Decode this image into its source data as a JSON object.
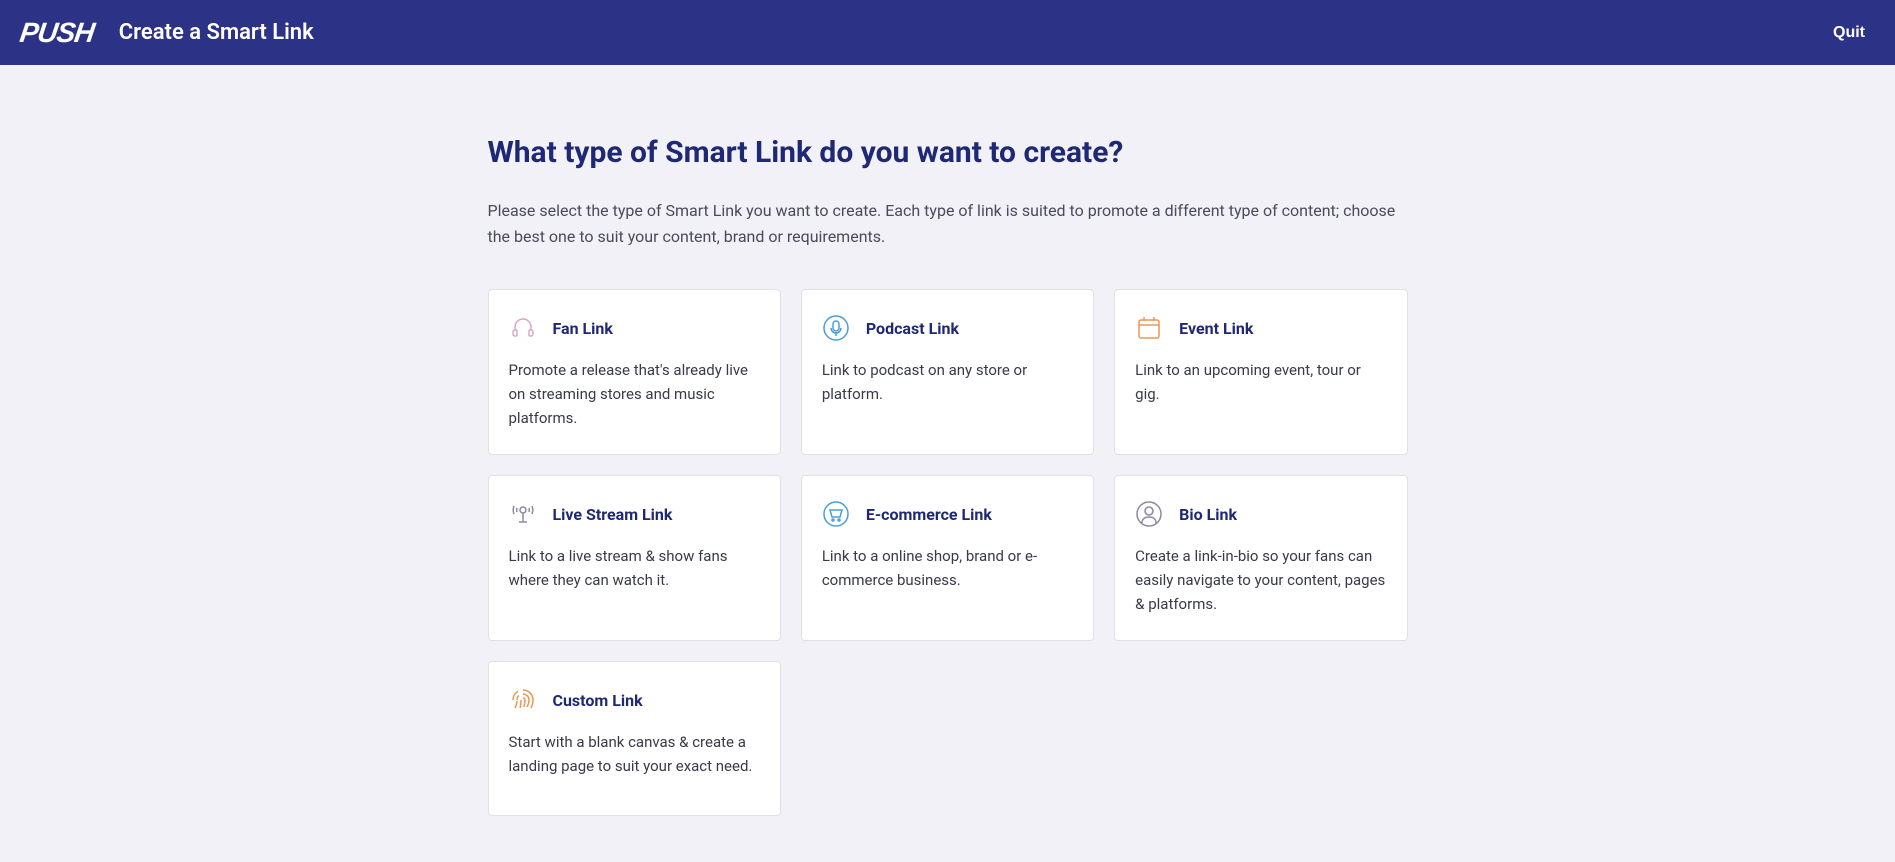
{
  "header": {
    "logo": "PUSH",
    "title": "Create a Smart Link",
    "quit_label": "Quit"
  },
  "main": {
    "heading": "What type of Smart Link do you want to create?",
    "description": "Please select the type of Smart Link you want to create. Each type of link is suited to promote a different type of content; choose the best one to suit your content, brand or requirements."
  },
  "cards": [
    {
      "icon": "headphones-icon",
      "title": "Fan Link",
      "description": "Promote a release that's already live on streaming stores and music platforms."
    },
    {
      "icon": "microphone-icon",
      "title": "Podcast Link",
      "description": "Link to podcast on any store or platform."
    },
    {
      "icon": "calendar-icon",
      "title": "Event Link",
      "description": "Link to an upcoming event, tour or gig."
    },
    {
      "icon": "broadcast-icon",
      "title": "Live Stream Link",
      "description": "Link to a live stream & show fans where they can watch it."
    },
    {
      "icon": "cart-icon",
      "title": "E-commerce Link",
      "description": "Link to a online shop, brand or e-commerce business."
    },
    {
      "icon": "person-icon",
      "title": "Bio Link",
      "description": "Create a link-in-bio so your fans can easily navigate to your content, pages & platforms."
    },
    {
      "icon": "fingerprint-icon",
      "title": "Custom Link",
      "description": "Start with a blank canvas & create a landing page to suit your exact need."
    }
  ]
}
